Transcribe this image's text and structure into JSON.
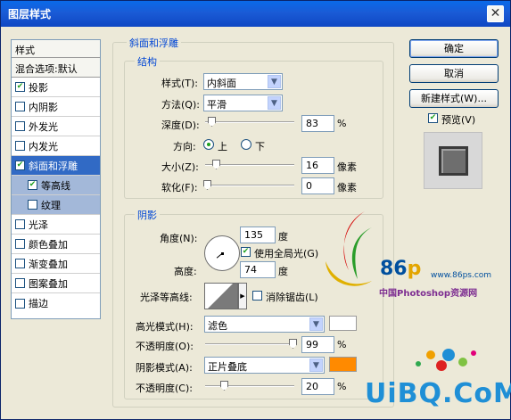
{
  "window": {
    "title": "图层样式",
    "close_glyph": "✕"
  },
  "sidebar": {
    "header": "样式",
    "blend": "混合选项:默认",
    "items": [
      {
        "label": "投影",
        "checked": true
      },
      {
        "label": "内阴影",
        "checked": false
      },
      {
        "label": "外发光",
        "checked": false
      },
      {
        "label": "内发光",
        "checked": false
      },
      {
        "label": "斜面和浮雕",
        "checked": true
      },
      {
        "label": "等高线",
        "checked": true
      },
      {
        "label": "纹理",
        "checked": false
      },
      {
        "label": "光泽",
        "checked": false
      },
      {
        "label": "颜色叠加",
        "checked": false
      },
      {
        "label": "渐变叠加",
        "checked": false
      },
      {
        "label": "图案叠加",
        "checked": false
      },
      {
        "label": "描边",
        "checked": false
      }
    ]
  },
  "bevel": {
    "section_title": "斜面和浮雕",
    "structure_title": "结构",
    "style_label": "样式(T):",
    "style_value": "内斜面",
    "technique_label": "方法(Q):",
    "technique_value": "平滑",
    "depth_label": "深度(D):",
    "depth_value": "83",
    "depth_unit": "%",
    "direction_label": "方向:",
    "direction_up": "上",
    "direction_down": "下",
    "size_label": "大小(Z):",
    "size_value": "16",
    "size_unit": "像素",
    "soften_label": "软化(F):",
    "soften_value": "0",
    "soften_unit": "像素"
  },
  "shading": {
    "title": "阴影",
    "angle_label": "角度(N):",
    "angle_value": "135",
    "angle_unit": "度",
    "global_light_label": "使用全局光(G)",
    "altitude_label": "高度:",
    "altitude_value": "74",
    "altitude_unit": "度",
    "gloss_label": "光泽等高线:",
    "antialias_label": "消除锯齿(L)",
    "highlight_mode_label": "高光模式(H):",
    "highlight_mode_value": "滤色",
    "highlight_color": "#ffffff",
    "highlight_opacity_label": "不透明度(O):",
    "highlight_opacity_value": "99",
    "opacity_unit": "%",
    "shadow_mode_label": "阴影模式(A):",
    "shadow_mode_value": "正片叠底",
    "shadow_color": "#ff8a00",
    "shadow_opacity_label": "不透明度(C):",
    "shadow_opacity_value": "20"
  },
  "right_panel": {
    "ok": "确定",
    "cancel": "取消",
    "new_style": "新建样式(W)...",
    "preview_label": "预览(V)"
  },
  "watermark": {
    "brand_86": "86",
    "brand_p": "p",
    "url": "www.86ps.com",
    "cn": "中国Photoshop资源网",
    "uibq": "UiBQ.CoM"
  }
}
